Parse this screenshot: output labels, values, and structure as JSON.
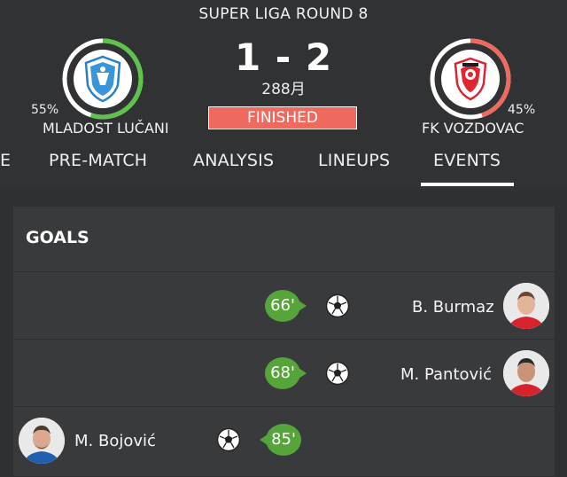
{
  "match": {
    "round_title": "SUPER LIGA ROUND 8",
    "score": "1 - 2",
    "score_sub": "288月",
    "status": "FINISHED"
  },
  "home": {
    "name": "MLADOST LUČANI",
    "possession": "55%",
    "possession_value": 0.55,
    "ring_color": "#5dc34a"
  },
  "away": {
    "name": "FK VOZDOVAC",
    "possession": "45%",
    "possession_value": 0.45,
    "ring_color": "#ef6a5e"
  },
  "tabs": [
    {
      "label": "E"
    },
    {
      "label": "PRE-MATCH"
    },
    {
      "label": "ANALYSIS"
    },
    {
      "label": "LINEUPS"
    },
    {
      "label": "EVENTS",
      "active": true
    }
  ],
  "goals": {
    "title": "GOALS",
    "events": [
      {
        "minute": "66'",
        "player": "B. Burmaz",
        "side": "away"
      },
      {
        "minute": "68'",
        "player": "M. Pantović",
        "side": "away"
      },
      {
        "minute": "85'",
        "player": "M. Bojović",
        "side": "home"
      }
    ]
  }
}
